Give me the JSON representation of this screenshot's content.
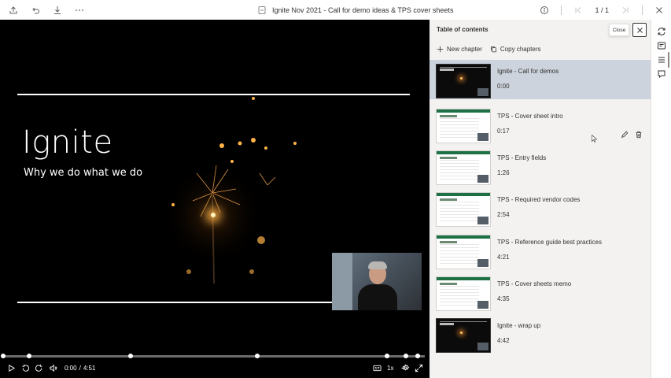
{
  "topbar": {
    "document_title": "Ignite Nov 2021 - Call for demo ideas & TPS cover sheets",
    "page_indicator": "1 / 1",
    "icons": [
      "share-icon",
      "undo-icon",
      "download-icon",
      "more-icon",
      "file-icon",
      "info-icon",
      "first-page-icon",
      "last-page-icon",
      "close-icon"
    ]
  },
  "slide": {
    "title": "Ignite",
    "subtitle": "Why we do what we do"
  },
  "player": {
    "current_time": "0:00",
    "separator": "/",
    "duration": "4:51",
    "speed": "1x",
    "progress_fraction": 0.0,
    "chapter_markers_fraction": [
      0.0,
      0.062,
      0.302,
      0.602,
      0.911,
      0.955,
      0.983
    ]
  },
  "toc": {
    "header": "Table of contents",
    "close_tooltip": "Close",
    "new_chapter": "New chapter",
    "copy_chapters": "Copy chapters",
    "chapters": [
      {
        "title": "Ignite - Call for demos",
        "time": "0:00",
        "thumb": "dark",
        "selected": true
      },
      {
        "title": "TPS - Cover sheet intro",
        "time": "0:17",
        "thumb": "sheet",
        "selected": false,
        "hover_tools": true
      },
      {
        "title": "TPS - Entry fields",
        "time": "1:26",
        "thumb": "sheet",
        "selected": false
      },
      {
        "title": "TPS - Required vendor codes",
        "time": "2:54",
        "thumb": "sheet",
        "selected": false
      },
      {
        "title": "TPS - Reference guide best practices",
        "time": "4:21",
        "thumb": "sheet",
        "selected": false
      },
      {
        "title": "TPS - Cover sheets memo",
        "time": "4:35",
        "thumb": "sheet",
        "selected": false
      },
      {
        "title": "Ignite - wrap up",
        "time": "4:42",
        "thumb": "dark",
        "selected": false
      }
    ]
  },
  "rail": {
    "icons": [
      "sync-icon",
      "notes-icon",
      "chapters-icon",
      "comment-icon"
    ]
  },
  "colors": {
    "selected_row": "#cdd3dd",
    "panel_bg": "#f3f2f1",
    "sheet_green": "#1e7145"
  }
}
